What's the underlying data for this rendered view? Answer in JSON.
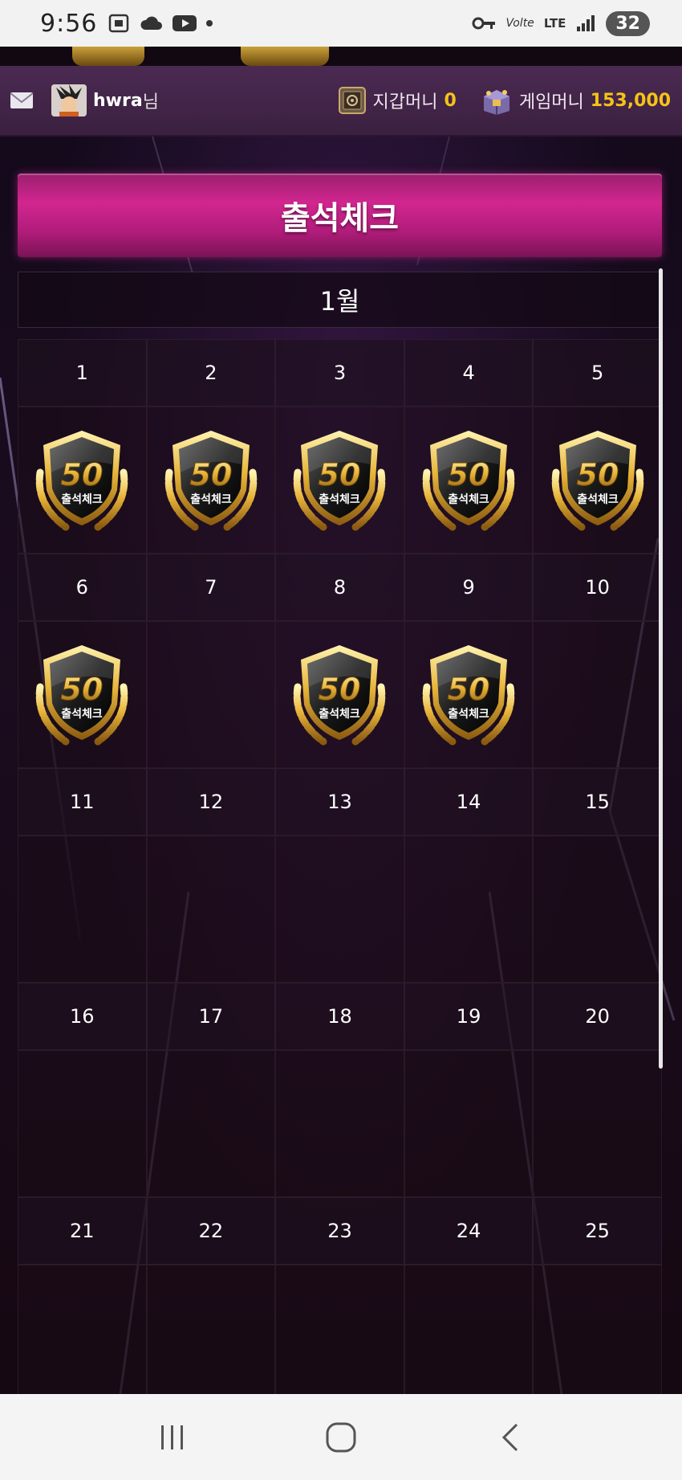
{
  "status_bar": {
    "time": "9:56",
    "battery": "32",
    "network": "LTE",
    "volte": "Volte"
  },
  "header": {
    "username": "hwra",
    "username_suffix": "님",
    "wallet_label": "지갑머니",
    "wallet_value": "0",
    "game_label": "게임머니",
    "game_value": "153,000"
  },
  "page": {
    "title": "출석체크",
    "month": "1월"
  },
  "stamp": {
    "number": "50",
    "label": "출석체크"
  },
  "calendar": {
    "weeks": [
      {
        "days": [
          {
            "num": "1",
            "checked": true
          },
          {
            "num": "2",
            "checked": true
          },
          {
            "num": "3",
            "checked": true
          },
          {
            "num": "4",
            "checked": true
          },
          {
            "num": "5",
            "checked": true
          }
        ]
      },
      {
        "days": [
          {
            "num": "6",
            "checked": true
          },
          {
            "num": "7",
            "checked": false
          },
          {
            "num": "8",
            "checked": true
          },
          {
            "num": "9",
            "checked": true
          },
          {
            "num": "10",
            "checked": false
          }
        ]
      },
      {
        "days": [
          {
            "num": "11",
            "checked": false
          },
          {
            "num": "12",
            "checked": false
          },
          {
            "num": "13",
            "checked": false
          },
          {
            "num": "14",
            "checked": false
          },
          {
            "num": "15",
            "checked": false
          }
        ]
      },
      {
        "days": [
          {
            "num": "16",
            "checked": false
          },
          {
            "num": "17",
            "checked": false
          },
          {
            "num": "18",
            "checked": false
          },
          {
            "num": "19",
            "checked": false
          },
          {
            "num": "20",
            "checked": false
          }
        ]
      },
      {
        "days": [
          {
            "num": "21",
            "checked": false
          },
          {
            "num": "22",
            "checked": false
          },
          {
            "num": "23",
            "checked": false
          },
          {
            "num": "24",
            "checked": false
          },
          {
            "num": "25",
            "checked": false
          }
        ]
      }
    ]
  },
  "icons": {
    "mail": "mail-icon",
    "wallet": "wallet-icon",
    "game_money": "treasure-chest-icon",
    "nav_recent": "recent-apps-icon",
    "nav_home": "home-icon",
    "nav_back": "back-icon"
  },
  "colors": {
    "title_bar": "#d2268f",
    "money_value": "#f5c318",
    "header_bg": "#4b2a52"
  }
}
